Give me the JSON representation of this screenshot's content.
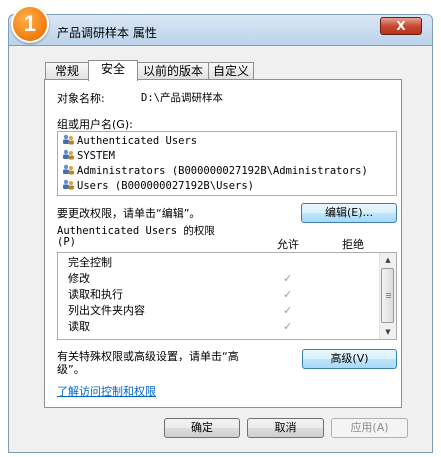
{
  "window": {
    "title": "产品调研样本 属性",
    "close_label": "X",
    "step_badge": "1"
  },
  "tabs": [
    {
      "label": "常规",
      "active": false
    },
    {
      "label": "安全",
      "active": true
    },
    {
      "label": "以前的版本",
      "active": false
    },
    {
      "label": "自定义",
      "active": false
    }
  ],
  "object": {
    "label": "对象名称:",
    "value": "D:\\产品调研样本"
  },
  "group": {
    "label": "组或用户名(G):",
    "users": [
      "Authenticated Users",
      "SYSTEM",
      "Administrators (B000000027192B\\Administrators)",
      "Users (B000000027192B\\Users)"
    ]
  },
  "edit": {
    "hint": "要更改权限，请单击“编辑”。",
    "button": "编辑(E)..."
  },
  "permissions": {
    "title_line1": "Authenticated Users 的权限",
    "title_line2": "(P)",
    "allow_header": "允许",
    "deny_header": "拒绝",
    "rows": [
      {
        "name": "完全控制",
        "allow": ""
      },
      {
        "name": "修改",
        "allow": "✓"
      },
      {
        "name": "读取和执行",
        "allow": "✓"
      },
      {
        "name": "列出文件夹内容",
        "allow": "✓"
      },
      {
        "name": "读取",
        "allow": "✓"
      }
    ]
  },
  "advanced": {
    "hint_line1": "有关特殊权限或高级设置，请单击“高",
    "hint_line2": "级”。",
    "button": "高级(V)"
  },
  "link": "了解访问控制和权限",
  "footer": {
    "ok": "确定",
    "cancel": "取消",
    "apply": "应用(A)"
  }
}
